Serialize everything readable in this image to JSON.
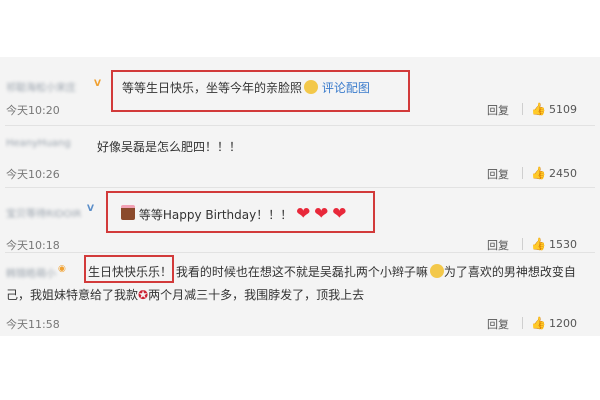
{
  "comments": [
    {
      "user": "祁聪海松小宋庄",
      "text": "等等生日快乐，坐等今年的亲脸照",
      "link": "评论配图",
      "time": "今天10:20",
      "reply": "回复",
      "likes": "5109"
    },
    {
      "user": "HeanyHuang",
      "text": "好像吴磊是怎么肥四！！！",
      "time": "10:26",
      "time_prefix": "今天",
      "reply": "回复",
      "likes": "2450"
    },
    {
      "user": "宝贝等待RIDOIR",
      "text": "等等Happy Birthday！！！",
      "time": "今天10:18",
      "reply": "回复",
      "likes": "1530"
    },
    {
      "user": "韩锦皓萌小",
      "highlight": "生日快快乐乐！",
      "text_rest": "我看的时候也在想这不就是吴磊扎两个小辫子嘛",
      "text_rest2": "为了喜欢的男神想改变自",
      "line2a": "己，我姐妹特意给了我款",
      "line2b": "两个月减三十多，我围脖发了，顶我上去",
      "time": "今天11:58",
      "reply": "回复",
      "likes": "1200"
    }
  ],
  "icons": {
    "like": "thumbs-up-icon",
    "verified": "verified-badge-icon"
  },
  "colors": {
    "highlight_box": "#d23a3a",
    "heart": "#e8283a",
    "link": "#3b7ccc",
    "panel_bg": "#f4f4f4"
  }
}
